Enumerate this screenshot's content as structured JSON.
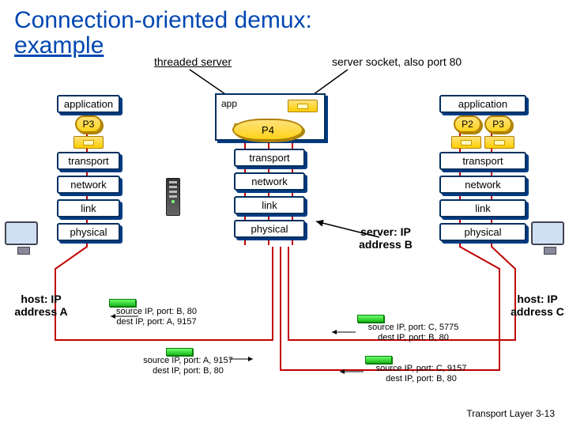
{
  "title_line1": "Connection-oriented demux:",
  "title_line2": "example",
  "annot_threaded": "threaded server",
  "annot_serversock": "server socket, also port 80",
  "layers": {
    "application": "application",
    "transport": "transport",
    "network": "network",
    "link": "link",
    "physical": "physical"
  },
  "app_label": "app",
  "procs": {
    "P2": "P2",
    "P3": "P3",
    "P4": "P4"
  },
  "hosts": {
    "A": "host: IP address A",
    "B": "server: IP address B",
    "C": "host: IP address C"
  },
  "packets": {
    "p1l1": "source IP, port: B, 80",
    "p1l2": "dest IP, port: A, 9157",
    "p2l1": "source IP, port: A, 9157",
    "p2l2": "dest IP, port: B, 80",
    "p3l1": "source IP, port: C, 5775",
    "p3l2": "dest IP, port: B, 80",
    "p4l1": "source IP, port: C, 9157",
    "p4l2": "dest IP, port: B, 80"
  },
  "footer": "Transport Layer",
  "slidenum": "3-13"
}
